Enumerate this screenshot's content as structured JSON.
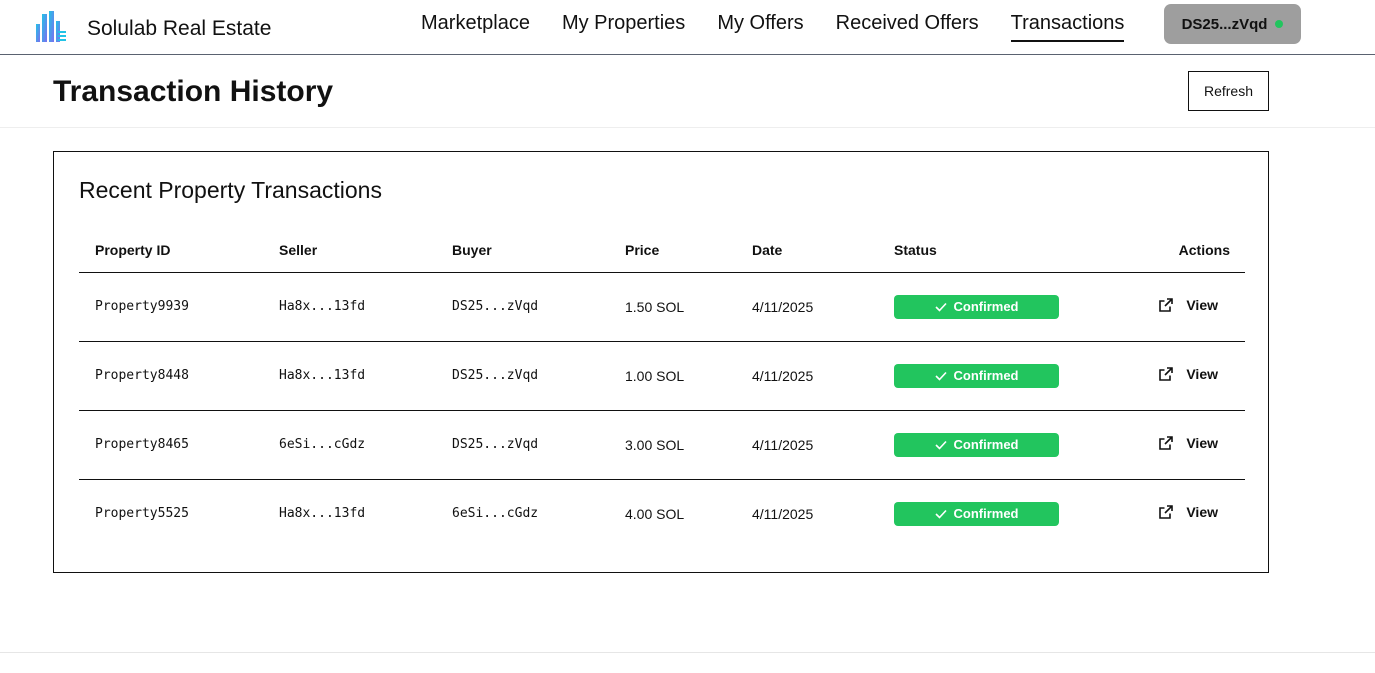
{
  "app": {
    "name": "Solulab Real Estate"
  },
  "nav": {
    "links": [
      "Marketplace",
      "My Properties",
      "My Offers",
      "Received Offers",
      "Transactions"
    ],
    "active": "Transactions",
    "wallet": "DS25...zVqd"
  },
  "page": {
    "title": "Transaction History",
    "refresh_label": "Refresh"
  },
  "card": {
    "title": "Recent Property Transactions",
    "columns": [
      "Property ID",
      "Seller",
      "Buyer",
      "Price",
      "Date",
      "Status",
      "Actions"
    ],
    "rows": [
      {
        "property_id": "Property9939",
        "seller": "Ha8x...13fd",
        "buyer": "DS25...zVqd",
        "price": "1.50 SOL",
        "date": "4/11/2025",
        "status": "Confirmed",
        "action": "View"
      },
      {
        "property_id": "Property8448",
        "seller": "Ha8x...13fd",
        "buyer": "DS25...zVqd",
        "price": "1.00 SOL",
        "date": "4/11/2025",
        "status": "Confirmed",
        "action": "View"
      },
      {
        "property_id": "Property8465",
        "seller": "6eSi...cGdz",
        "buyer": "DS25...zVqd",
        "price": "3.00 SOL",
        "date": "4/11/2025",
        "status": "Confirmed",
        "action": "View"
      },
      {
        "property_id": "Property5525",
        "seller": "Ha8x...13fd",
        "buyer": "6eSi...cGdz",
        "price": "4.00 SOL",
        "date": "4/11/2025",
        "status": "Confirmed",
        "action": "View"
      }
    ]
  },
  "icons": {
    "logo": "building-logo-icon",
    "status": "check-icon",
    "action": "external-link-icon"
  },
  "colors": {
    "status_confirmed": "#22c55e",
    "wallet_bg": "#9e9e9e",
    "wallet_dot": "#22c55e"
  }
}
